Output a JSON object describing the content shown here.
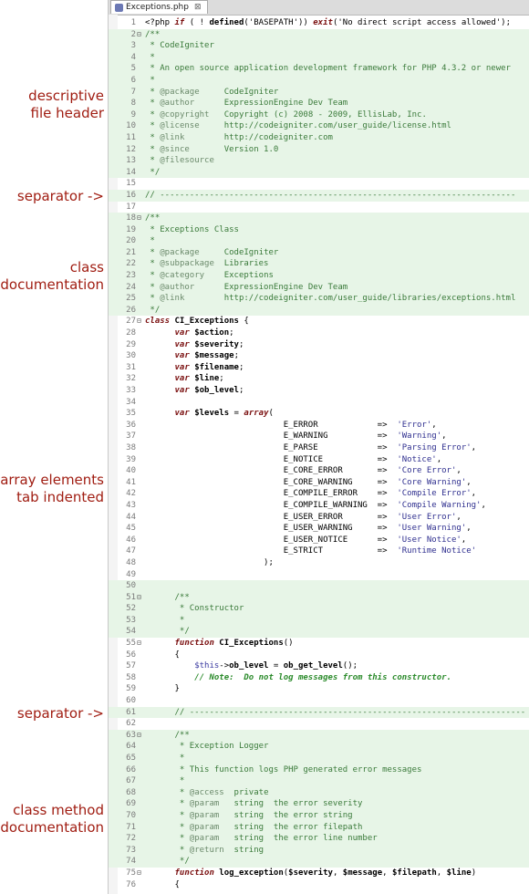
{
  "tab": {
    "title": "Exceptions.php",
    "close": "⊠"
  },
  "annotations": [
    {
      "name": "annot-file-header",
      "text": "descriptive\nfile header"
    },
    {
      "name": "annot-separator-1",
      "text": "separator ->"
    },
    {
      "name": "annot-class-doc",
      "text": "class\ndocumentation"
    },
    {
      "name": "annot-array-elements",
      "text": "array elements\ntab indented"
    },
    {
      "name": "annot-separator-2",
      "text": "separator ->"
    },
    {
      "name": "annot-method-doc",
      "text": "class method\ndocumentation"
    }
  ],
  "lines": [
    {
      "n": "1",
      "fold": "",
      "bg": "",
      "s": [
        [
          "k",
          "<?php "
        ],
        [
          "kw",
          "if"
        ],
        [
          "k",
          " ( ! "
        ],
        [
          "kwb",
          "defined"
        ],
        [
          "k",
          "('BASEPATH')) "
        ],
        [
          "kw",
          "exit"
        ],
        [
          "k",
          "('No direct script access allowed');"
        ]
      ]
    },
    {
      "n": "2",
      "fold": "⊟",
      "bg": "doc",
      "s": [
        [
          "c",
          "/**"
        ]
      ]
    },
    {
      "n": "3",
      "fold": "",
      "bg": "doc",
      "s": [
        [
          "c",
          " * CodeIgniter"
        ]
      ]
    },
    {
      "n": "4",
      "fold": "",
      "bg": "doc",
      "s": [
        [
          "c",
          " *"
        ]
      ]
    },
    {
      "n": "5",
      "fold": "",
      "bg": "doc",
      "s": [
        [
          "c",
          " * An open source application development framework for PHP 4.3.2 or newer"
        ]
      ]
    },
    {
      "n": "6",
      "fold": "",
      "bg": "doc",
      "s": [
        [
          "c",
          " *"
        ]
      ]
    },
    {
      "n": "7",
      "fold": "",
      "bg": "doc",
      "s": [
        [
          "c",
          " * "
        ],
        [
          "ctag",
          "@package"
        ],
        [
          "c",
          "     CodeIgniter"
        ]
      ]
    },
    {
      "n": "8",
      "fold": "",
      "bg": "doc",
      "s": [
        [
          "c",
          " * "
        ],
        [
          "ctag",
          "@author"
        ],
        [
          "c",
          "      ExpressionEngine Dev Team"
        ]
      ]
    },
    {
      "n": "9",
      "fold": "",
      "bg": "doc",
      "s": [
        [
          "c",
          " * "
        ],
        [
          "ctag",
          "@copyright"
        ],
        [
          "c",
          "   Copyright (c) 2008 - 2009, EllisLab, Inc."
        ]
      ]
    },
    {
      "n": "10",
      "fold": "",
      "bg": "doc",
      "s": [
        [
          "c",
          " * "
        ],
        [
          "ctag",
          "@license"
        ],
        [
          "c",
          "     http://codeigniter.com/user_guide/license.html"
        ]
      ]
    },
    {
      "n": "11",
      "fold": "",
      "bg": "doc",
      "s": [
        [
          "c",
          " * "
        ],
        [
          "ctag",
          "@link"
        ],
        [
          "c",
          "        http://codeigniter.com"
        ]
      ]
    },
    {
      "n": "12",
      "fold": "",
      "bg": "doc",
      "s": [
        [
          "c",
          " * "
        ],
        [
          "ctag",
          "@since"
        ],
        [
          "c",
          "       Version 1.0"
        ]
      ]
    },
    {
      "n": "13",
      "fold": "",
      "bg": "doc",
      "s": [
        [
          "c",
          " * "
        ],
        [
          "ctag",
          "@filesource"
        ]
      ]
    },
    {
      "n": "14",
      "fold": "",
      "bg": "doc",
      "s": [
        [
          "c",
          " */"
        ]
      ]
    },
    {
      "n": "15",
      "fold": "",
      "bg": "",
      "s": []
    },
    {
      "n": "16",
      "fold": "",
      "bg": "sep",
      "s": [
        [
          "c",
          "// ------------------------------------------------------------------------"
        ]
      ]
    },
    {
      "n": "17",
      "fold": "",
      "bg": "",
      "s": []
    },
    {
      "n": "18",
      "fold": "⊟",
      "bg": "doc",
      "s": [
        [
          "c",
          "/**"
        ]
      ]
    },
    {
      "n": "19",
      "fold": "",
      "bg": "doc",
      "s": [
        [
          "c",
          " * Exceptions Class"
        ]
      ]
    },
    {
      "n": "20",
      "fold": "",
      "bg": "doc",
      "s": [
        [
          "c",
          " *"
        ]
      ]
    },
    {
      "n": "21",
      "fold": "",
      "bg": "doc",
      "s": [
        [
          "c",
          " * "
        ],
        [
          "ctag",
          "@package"
        ],
        [
          "c",
          "     CodeIgniter"
        ]
      ]
    },
    {
      "n": "22",
      "fold": "",
      "bg": "doc",
      "s": [
        [
          "c",
          " * "
        ],
        [
          "ctag",
          "@subpackage"
        ],
        [
          "c",
          "  Libraries"
        ]
      ]
    },
    {
      "n": "23",
      "fold": "",
      "bg": "doc",
      "s": [
        [
          "c",
          " * "
        ],
        [
          "ctag",
          "@category"
        ],
        [
          "c",
          "    Exceptions"
        ]
      ]
    },
    {
      "n": "24",
      "fold": "",
      "bg": "doc",
      "s": [
        [
          "c",
          " * "
        ],
        [
          "ctag",
          "@author"
        ],
        [
          "c",
          "      ExpressionEngine Dev Team"
        ]
      ]
    },
    {
      "n": "25",
      "fold": "",
      "bg": "doc",
      "s": [
        [
          "c",
          " * "
        ],
        [
          "ctag",
          "@link"
        ],
        [
          "c",
          "        http://codeigniter.com/user_guide/libraries/exceptions.html"
        ]
      ]
    },
    {
      "n": "26",
      "fold": "",
      "bg": "doc",
      "s": [
        [
          "c",
          " */"
        ]
      ]
    },
    {
      "n": "27",
      "fold": "⊟",
      "bg": "",
      "s": [
        [
          "kw",
          "class"
        ],
        [
          "k",
          " "
        ],
        [
          "kwb",
          "CI_Exceptions"
        ],
        [
          "k",
          " {"
        ]
      ]
    },
    {
      "n": "28",
      "fold": "",
      "bg": "",
      "s": [
        [
          "k",
          "      "
        ],
        [
          "kw",
          "var"
        ],
        [
          "k",
          " "
        ],
        [
          "var",
          "$action"
        ],
        [
          "k",
          ";"
        ]
      ]
    },
    {
      "n": "29",
      "fold": "",
      "bg": "",
      "s": [
        [
          "k",
          "      "
        ],
        [
          "kw",
          "var"
        ],
        [
          "k",
          " "
        ],
        [
          "var",
          "$severity"
        ],
        [
          "k",
          ";"
        ]
      ]
    },
    {
      "n": "30",
      "fold": "",
      "bg": "",
      "s": [
        [
          "k",
          "      "
        ],
        [
          "kw",
          "var"
        ],
        [
          "k",
          " "
        ],
        [
          "var",
          "$message"
        ],
        [
          "k",
          ";"
        ]
      ]
    },
    {
      "n": "31",
      "fold": "",
      "bg": "",
      "s": [
        [
          "k",
          "      "
        ],
        [
          "kw",
          "var"
        ],
        [
          "k",
          " "
        ],
        [
          "var",
          "$filename"
        ],
        [
          "k",
          ";"
        ]
      ]
    },
    {
      "n": "32",
      "fold": "",
      "bg": "",
      "s": [
        [
          "k",
          "      "
        ],
        [
          "kw",
          "var"
        ],
        [
          "k",
          " "
        ],
        [
          "var",
          "$line"
        ],
        [
          "k",
          ";"
        ]
      ]
    },
    {
      "n": "33",
      "fold": "",
      "bg": "",
      "s": [
        [
          "k",
          "      "
        ],
        [
          "kw",
          "var"
        ],
        [
          "k",
          " "
        ],
        [
          "var",
          "$ob_level"
        ],
        [
          "k",
          ";"
        ]
      ]
    },
    {
      "n": "34",
      "fold": "",
      "bg": "",
      "s": []
    },
    {
      "n": "35",
      "fold": "",
      "bg": "",
      "s": [
        [
          "k",
          "      "
        ],
        [
          "kw",
          "var"
        ],
        [
          "k",
          " "
        ],
        [
          "var",
          "$levels"
        ],
        [
          "k",
          " = "
        ],
        [
          "kw",
          "array"
        ],
        [
          "k",
          "("
        ]
      ]
    },
    {
      "n": "36",
      "fold": "",
      "bg": "",
      "s": [
        [
          "k",
          "                            E_ERROR            =>  "
        ],
        [
          "str",
          "'Error'"
        ],
        [
          "k",
          ","
        ]
      ]
    },
    {
      "n": "37",
      "fold": "",
      "bg": "",
      "s": [
        [
          "k",
          "                            E_WARNING          =>  "
        ],
        [
          "str",
          "'Warning'"
        ],
        [
          "k",
          ","
        ]
      ]
    },
    {
      "n": "38",
      "fold": "",
      "bg": "",
      "s": [
        [
          "k",
          "                            E_PARSE            =>  "
        ],
        [
          "str",
          "'Parsing Error'"
        ],
        [
          "k",
          ","
        ]
      ]
    },
    {
      "n": "39",
      "fold": "",
      "bg": "",
      "s": [
        [
          "k",
          "                            E_NOTICE           =>  "
        ],
        [
          "str",
          "'Notice'"
        ],
        [
          "k",
          ","
        ]
      ]
    },
    {
      "n": "40",
      "fold": "",
      "bg": "",
      "s": [
        [
          "k",
          "                            E_CORE_ERROR       =>  "
        ],
        [
          "str",
          "'Core Error'"
        ],
        [
          "k",
          ","
        ]
      ]
    },
    {
      "n": "41",
      "fold": "",
      "bg": "",
      "s": [
        [
          "k",
          "                            E_CORE_WARNING     =>  "
        ],
        [
          "str",
          "'Core Warning'"
        ],
        [
          "k",
          ","
        ]
      ]
    },
    {
      "n": "42",
      "fold": "",
      "bg": "",
      "s": [
        [
          "k",
          "                            E_COMPILE_ERROR    =>  "
        ],
        [
          "str",
          "'Compile Error'"
        ],
        [
          "k",
          ","
        ]
      ]
    },
    {
      "n": "43",
      "fold": "",
      "bg": "",
      "s": [
        [
          "k",
          "                            E_COMPILE_WARNING  =>  "
        ],
        [
          "str",
          "'Compile Warning'"
        ],
        [
          "k",
          ","
        ]
      ]
    },
    {
      "n": "44",
      "fold": "",
      "bg": "",
      "s": [
        [
          "k",
          "                            E_USER_ERROR       =>  "
        ],
        [
          "str",
          "'User Error'"
        ],
        [
          "k",
          ","
        ]
      ]
    },
    {
      "n": "45",
      "fold": "",
      "bg": "",
      "s": [
        [
          "k",
          "                            E_USER_WARNING     =>  "
        ],
        [
          "str",
          "'User Warning'"
        ],
        [
          "k",
          ","
        ]
      ]
    },
    {
      "n": "46",
      "fold": "",
      "bg": "",
      "s": [
        [
          "k",
          "                            E_USER_NOTICE      =>  "
        ],
        [
          "str",
          "'User Notice'"
        ],
        [
          "k",
          ","
        ]
      ]
    },
    {
      "n": "47",
      "fold": "",
      "bg": "",
      "s": [
        [
          "k",
          "                            E_STRICT           =>  "
        ],
        [
          "str",
          "'Runtime Notice'"
        ]
      ]
    },
    {
      "n": "48",
      "fold": "",
      "bg": "",
      "s": [
        [
          "k",
          "                        );"
        ]
      ]
    },
    {
      "n": "49",
      "fold": "",
      "bg": "",
      "s": []
    },
    {
      "n": "50",
      "fold": "",
      "bg": "doc",
      "s": []
    },
    {
      "n": "51",
      "fold": "⊟",
      "bg": "doc",
      "s": [
        [
          "c",
          "      /**"
        ]
      ]
    },
    {
      "n": "52",
      "fold": "",
      "bg": "doc",
      "s": [
        [
          "c",
          "       * Constructor"
        ]
      ]
    },
    {
      "n": "53",
      "fold": "",
      "bg": "doc",
      "s": [
        [
          "c",
          "       *"
        ]
      ]
    },
    {
      "n": "54",
      "fold": "",
      "bg": "doc",
      "s": [
        [
          "c",
          "       */"
        ]
      ]
    },
    {
      "n": "55",
      "fold": "⊟",
      "bg": "",
      "s": [
        [
          "k",
          "      "
        ],
        [
          "kw",
          "function"
        ],
        [
          "k",
          " "
        ],
        [
          "kwb",
          "CI_Exceptions"
        ],
        [
          "k",
          "()"
        ]
      ]
    },
    {
      "n": "56",
      "fold": "",
      "bg": "",
      "s": [
        [
          "k",
          "      {"
        ]
      ]
    },
    {
      "n": "57",
      "fold": "",
      "bg": "",
      "s": [
        [
          "k",
          "          "
        ],
        [
          "this",
          "$this"
        ],
        [
          "k",
          "->"
        ],
        [
          "var",
          "ob_level"
        ],
        [
          "k",
          " = "
        ],
        [
          "kwb",
          "ob_get_level"
        ],
        [
          "k",
          "();"
        ]
      ]
    },
    {
      "n": "58",
      "fold": "",
      "bg": "",
      "s": [
        [
          "k",
          "          "
        ],
        [
          "note",
          "// Note:  Do not log messages from this constructor."
        ]
      ]
    },
    {
      "n": "59",
      "fold": "",
      "bg": "",
      "s": [
        [
          "k",
          "      }"
        ]
      ]
    },
    {
      "n": "60",
      "fold": "",
      "bg": "",
      "s": []
    },
    {
      "n": "61",
      "fold": "",
      "bg": "sep",
      "s": [
        [
          "c",
          "      // --------------------------------------------------------------------"
        ]
      ]
    },
    {
      "n": "62",
      "fold": "",
      "bg": "",
      "s": []
    },
    {
      "n": "63",
      "fold": "⊟",
      "bg": "doc",
      "s": [
        [
          "c",
          "      /**"
        ]
      ]
    },
    {
      "n": "64",
      "fold": "",
      "bg": "doc",
      "s": [
        [
          "c",
          "       * Exception Logger"
        ]
      ]
    },
    {
      "n": "65",
      "fold": "",
      "bg": "doc",
      "s": [
        [
          "c",
          "       *"
        ]
      ]
    },
    {
      "n": "66",
      "fold": "",
      "bg": "doc",
      "s": [
        [
          "c",
          "       * This function logs PHP generated error messages"
        ]
      ]
    },
    {
      "n": "67",
      "fold": "",
      "bg": "doc",
      "s": [
        [
          "c",
          "       *"
        ]
      ]
    },
    {
      "n": "68",
      "fold": "",
      "bg": "doc",
      "s": [
        [
          "c",
          "       * "
        ],
        [
          "ctag",
          "@access"
        ],
        [
          "c",
          "  private"
        ]
      ]
    },
    {
      "n": "69",
      "fold": "",
      "bg": "doc",
      "s": [
        [
          "c",
          "       * "
        ],
        [
          "ctag",
          "@param"
        ],
        [
          "c",
          "   string  the error severity"
        ]
      ]
    },
    {
      "n": "70",
      "fold": "",
      "bg": "doc",
      "s": [
        [
          "c",
          "       * "
        ],
        [
          "ctag",
          "@param"
        ],
        [
          "c",
          "   string  the error string"
        ]
      ]
    },
    {
      "n": "71",
      "fold": "",
      "bg": "doc",
      "s": [
        [
          "c",
          "       * "
        ],
        [
          "ctag",
          "@param"
        ],
        [
          "c",
          "   string  the error filepath"
        ]
      ]
    },
    {
      "n": "72",
      "fold": "",
      "bg": "doc",
      "s": [
        [
          "c",
          "       * "
        ],
        [
          "ctag",
          "@param"
        ],
        [
          "c",
          "   string  the error line number"
        ]
      ]
    },
    {
      "n": "73",
      "fold": "",
      "bg": "doc",
      "s": [
        [
          "c",
          "       * "
        ],
        [
          "ctag",
          "@return"
        ],
        [
          "c",
          "  string"
        ]
      ]
    },
    {
      "n": "74",
      "fold": "",
      "bg": "doc",
      "s": [
        [
          "c",
          "       */"
        ]
      ]
    },
    {
      "n": "75",
      "fold": "⊟",
      "bg": "",
      "s": [
        [
          "k",
          "      "
        ],
        [
          "kw",
          "function"
        ],
        [
          "k",
          " "
        ],
        [
          "kwb",
          "log_exception"
        ],
        [
          "k",
          "("
        ],
        [
          "var",
          "$severity"
        ],
        [
          "k",
          ", "
        ],
        [
          "var",
          "$message"
        ],
        [
          "k",
          ", "
        ],
        [
          "var",
          "$filepath"
        ],
        [
          "k",
          ", "
        ],
        [
          "var",
          "$line"
        ],
        [
          "k",
          ")"
        ]
      ]
    },
    {
      "n": "76",
      "fold": "",
      "bg": "",
      "s": [
        [
          "k",
          "      {"
        ]
      ]
    }
  ]
}
